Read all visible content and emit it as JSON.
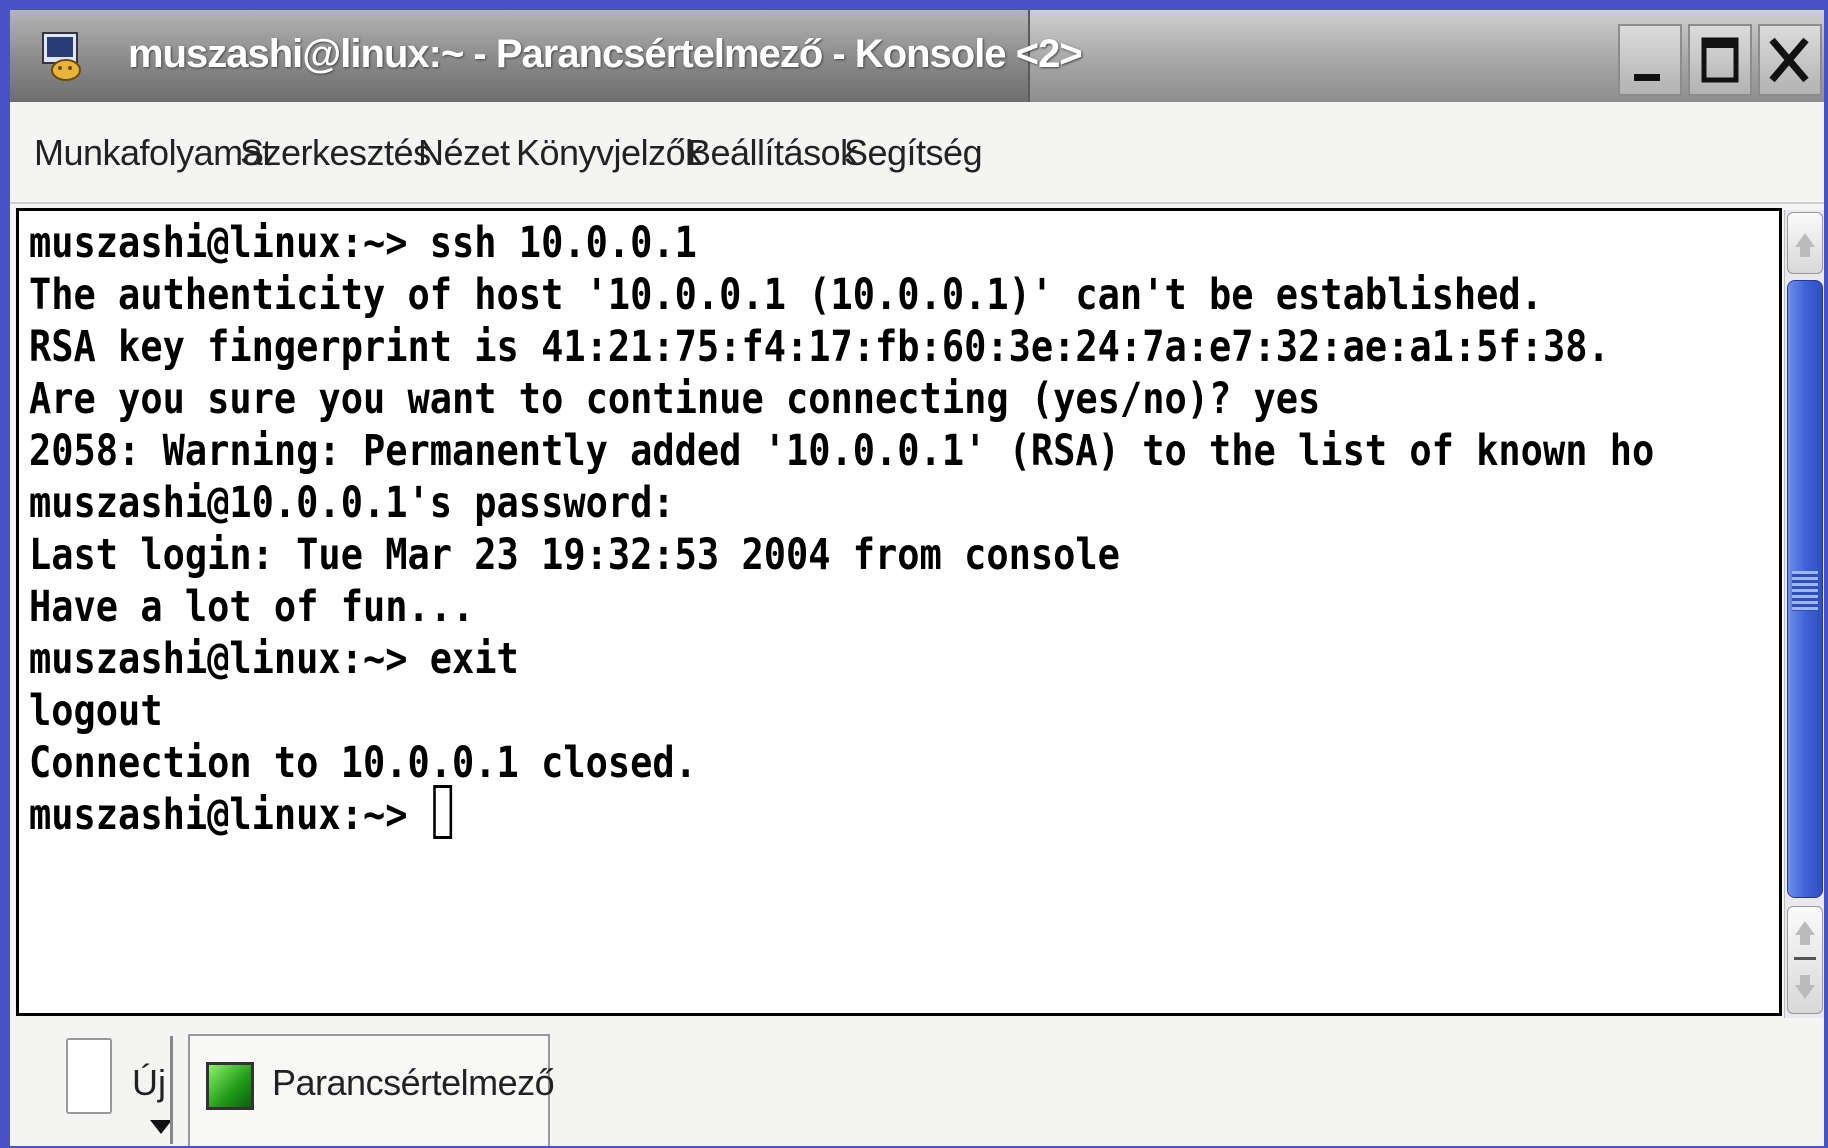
{
  "window": {
    "title": "muszashi@linux:~ - Parancsértelmező - Konsole <2>",
    "minimize_glyph": "_",
    "maximize_glyph": "☐",
    "close_glyph": "X"
  },
  "menu": {
    "items": [
      {
        "label": "Munkafolyamat"
      },
      {
        "label": "Szerkesztés"
      },
      {
        "label": "Nézet"
      },
      {
        "label": "Könyvjelzők"
      },
      {
        "label": "Beállítások"
      },
      {
        "label": "Segítség"
      }
    ]
  },
  "terminal": {
    "lines": [
      "muszashi@linux:~> ssh 10.0.0.1",
      "The authenticity of host '10.0.0.1 (10.0.0.1)' can't be established.",
      "RSA key fingerprint is 41:21:75:f4:17:fb:60:3e:24:7a:e7:32:ae:a1:5f:38.",
      "Are you sure you want to continue connecting (yes/no)? yes",
      "2058: Warning: Permanently added '10.0.0.1' (RSA) to the list of known ho",
      "muszashi@10.0.0.1's password:",
      "Last login: Tue Mar 23 19:32:53 2004 from console",
      "Have a lot of fun...",
      "muszashi@linux:~> exit",
      "logout",
      "Connection to 10.0.0.1 closed.",
      "muszashi@linux:~> "
    ]
  },
  "tabbar": {
    "new_label": "Új",
    "session_label": "Parancsértelmező"
  },
  "colors": {
    "desktop": "#4a52c8",
    "scroll_thumb": "#3f63d8",
    "terminal_bg": "#ffffff",
    "terminal_fg": "#000000"
  },
  "icons": {
    "app": "konsole-icon",
    "new_session": "document-icon",
    "session": "terminal-icon"
  }
}
